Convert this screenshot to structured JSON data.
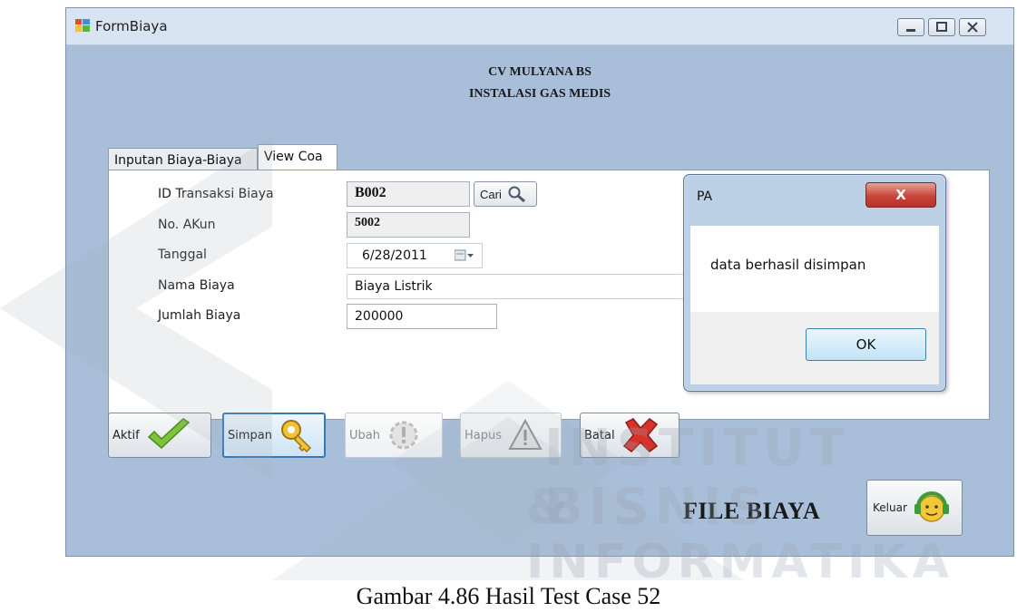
{
  "window": {
    "title": "FormBiaya"
  },
  "header": {
    "company": "CV MULYANA BS",
    "subtitle": "INSTALASI GAS MEDIS"
  },
  "tabs": [
    {
      "label": "Inputan Biaya-Biaya"
    },
    {
      "label": "View Coa"
    }
  ],
  "form": {
    "id_label": "ID Transaksi Biaya",
    "id_value": "B002",
    "search_label": "Cari",
    "akun_label": "No. AKun",
    "akun_value": "5002",
    "tanggal_label": "Tanggal",
    "tanggal_value": "6/28/2011",
    "nama_label": "Nama Biaya",
    "nama_value": "Biaya Listrik",
    "jumlah_label": "Jumlah Biaya",
    "jumlah_value": "200000"
  },
  "dialog": {
    "title": "PA",
    "close": "X",
    "message": "data berhasil disimpan",
    "ok": "OK"
  },
  "actions": {
    "aktif": "Aktif",
    "simpan": "Simpan",
    "ubah": "Ubah",
    "hapus": "Hapus",
    "batal": "Batal",
    "keluar": "Keluar"
  },
  "footer": {
    "title": "FILE BIAYA"
  },
  "watermark": {
    "line1": "INSTITUT BISNIS",
    "line2": "& INFORMATIKA"
  },
  "caption": "Gambar 4.86 Hasil Test Case 52",
  "colors": {
    "window_bg": "#a9bfd9",
    "titlebar": "#d8e4f1",
    "dialog_close": "#c8453a",
    "ok_border": "#3c7fb1"
  }
}
